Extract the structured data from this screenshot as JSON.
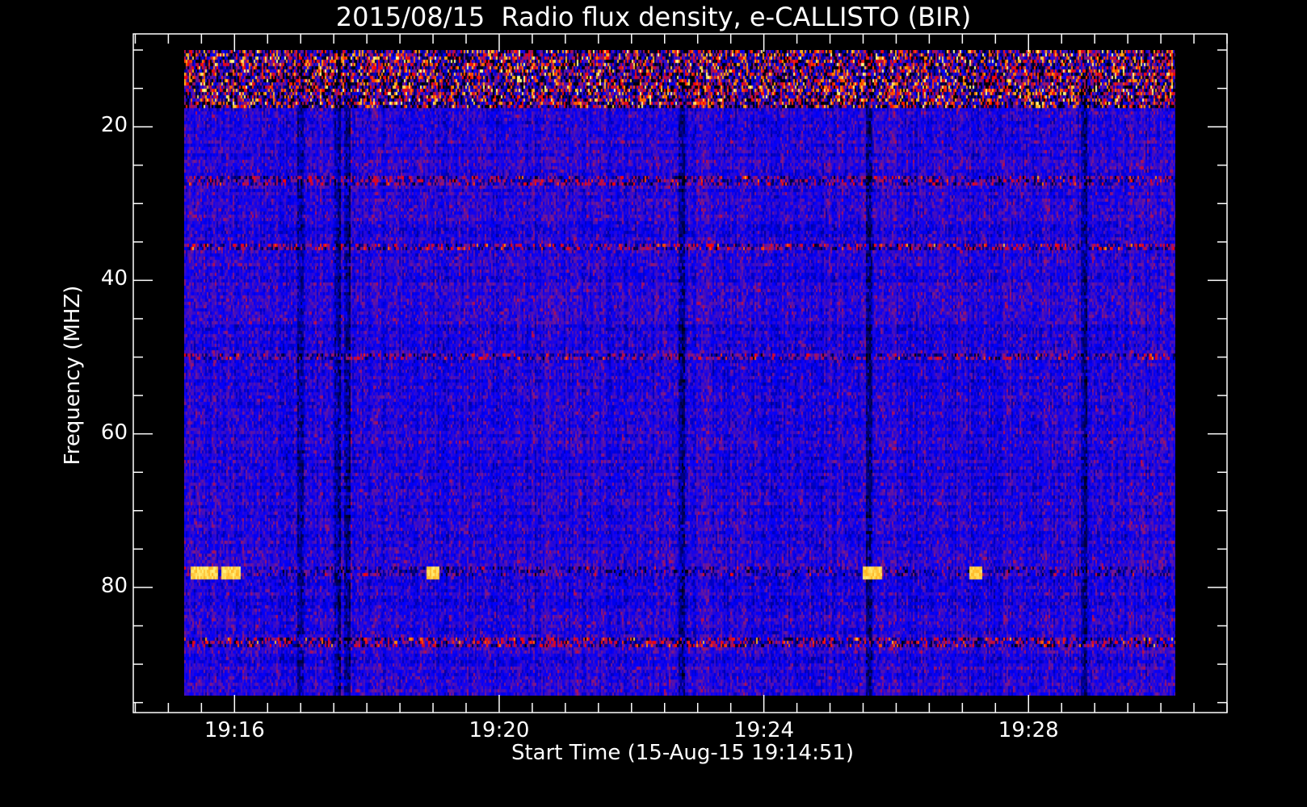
{
  "chart_data": {
    "type": "heatmap",
    "title": "2015/08/15  Radio flux density, e-CALLISTO (BIR)",
    "xlabel": "Start Time (15-Aug-15 19:14:51)",
    "ylabel": "Frequency (MHZ)",
    "x_unit": "minutes after 19:00 UT",
    "xlim": [
      14.47,
      31.0
    ],
    "ylim": [
      96.3,
      7.9
    ],
    "data_extent": {
      "x": [
        15.24,
        30.22
      ],
      "y": [
        10,
        94
      ]
    },
    "x_ticks": [
      {
        "value": 16,
        "label": "19:16"
      },
      {
        "value": 20,
        "label": "19:20"
      },
      {
        "value": 24,
        "label": "19:24"
      },
      {
        "value": 28,
        "label": "19:28"
      }
    ],
    "x_minor_step": 0.5,
    "y_ticks": [
      {
        "value": 20,
        "label": "20"
      },
      {
        "value": 40,
        "label": "40"
      },
      {
        "value": 60,
        "label": "60"
      },
      {
        "value": 80,
        "label": "80"
      }
    ],
    "y_minor_step": 5,
    "colormap": [
      "#000000",
      "#0000ff",
      "#7a1a8c",
      "#ff0000",
      "#ffa000",
      "#ffff90"
    ],
    "background_level": 0.33,
    "bright_bands_mhz": [
      {
        "f0": 10,
        "f1": 17.5,
        "level": 0.62
      },
      {
        "f0": 26.5,
        "f1": 27.5,
        "level": 0.5
      },
      {
        "f0": 35,
        "f1": 36,
        "level": 0.52
      },
      {
        "f0": 49.5,
        "f1": 50.3,
        "level": 0.48
      },
      {
        "f0": 86.5,
        "f1": 87.5,
        "level": 0.55
      },
      {
        "f0": 77,
        "f1": 78.5,
        "level": 0.42
      }
    ],
    "bursts": [
      {
        "t0": 15.33,
        "t1": 15.75,
        "f0": 77.2,
        "f1": 79
      },
      {
        "t0": 15.81,
        "t1": 16.1,
        "f0": 77.2,
        "f1": 79
      },
      {
        "t0": 18.9,
        "t1": 19.11,
        "f0": 77.2,
        "f1": 79
      },
      {
        "t0": 25.5,
        "t1": 25.78,
        "f0": 77.2,
        "f1": 79
      },
      {
        "t0": 27.1,
        "t1": 27.3,
        "f0": 77.2,
        "f1": 79
      }
    ],
    "dark_columns_min": [
      17.0,
      17.55,
      17.7,
      22.75,
      25.6,
      28.85
    ],
    "grid": false
  }
}
